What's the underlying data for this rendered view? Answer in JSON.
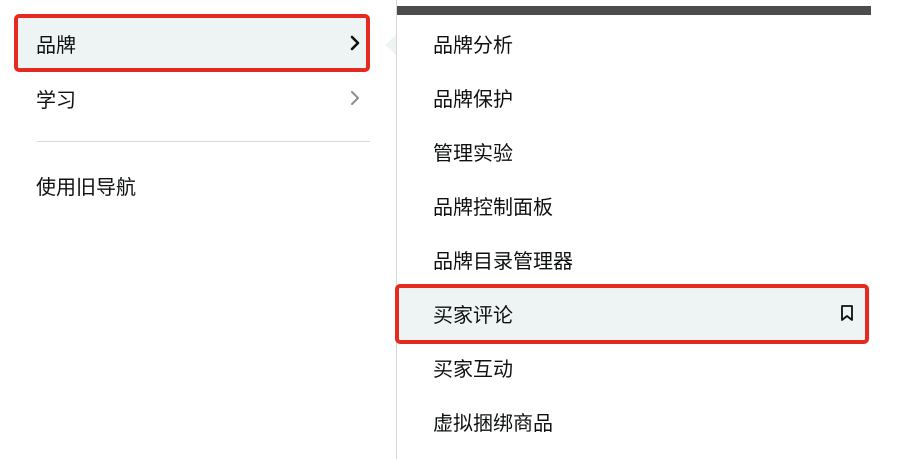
{
  "left_menu": {
    "items": [
      {
        "label": "品牌",
        "has_submenu": true,
        "active": true
      },
      {
        "label": "学习",
        "has_submenu": true,
        "active": false
      },
      {
        "label": "使用旧导航",
        "has_submenu": false,
        "active": false
      }
    ]
  },
  "submenu": {
    "items": [
      {
        "label": "品牌分析"
      },
      {
        "label": "品牌保护"
      },
      {
        "label": "管理实验"
      },
      {
        "label": "品牌控制面板"
      },
      {
        "label": "品牌目录管理器"
      },
      {
        "label": "买家评论",
        "active": true,
        "bookmark_icon": "bookmark-icon"
      },
      {
        "label": "买家互动"
      },
      {
        "label": "虚拟捆绑商品"
      }
    ]
  },
  "colors": {
    "highlight": "#e52a1f",
    "active_bg": "#eef3f3",
    "topbar": "#4c4c4c",
    "divider": "#d5d9d9"
  }
}
